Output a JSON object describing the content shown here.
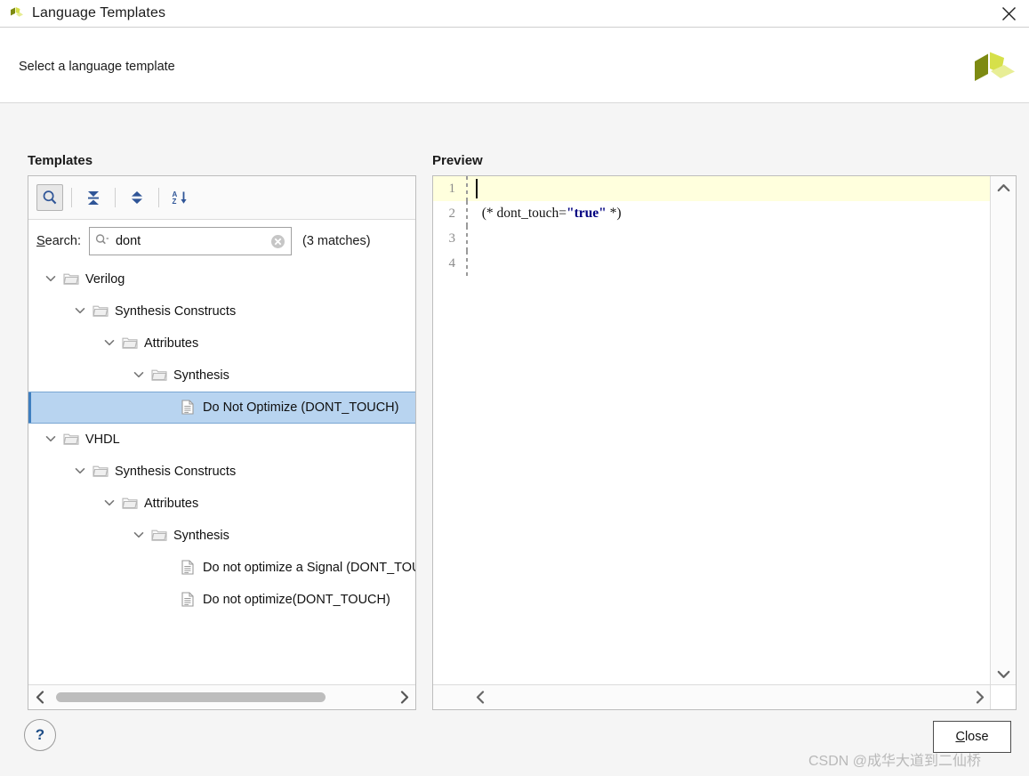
{
  "window": {
    "title": "Language Templates",
    "app_icon": "vivado-logo-icon",
    "close_icon": "close-icon"
  },
  "header": {
    "subtitle": "Select a language template",
    "brand_logo": "amd-xilinx-logo-icon"
  },
  "panels": {
    "templates_label": "Templates",
    "preview_label": "Preview"
  },
  "toolbar": {
    "buttons": [
      {
        "name": "search-toggle-button",
        "icon": "search-icon",
        "active": true
      },
      {
        "name": "collapse-all-button",
        "icon": "collapse-all-icon",
        "active": false
      },
      {
        "name": "expand-all-button",
        "icon": "expand-all-icon",
        "active": false
      },
      {
        "name": "sort-alphabetical-button",
        "icon": "sort-az-icon",
        "active": false
      }
    ]
  },
  "search": {
    "label_pre": "",
    "label_mnemonic": "S",
    "label_post": "earch:",
    "value": "dont",
    "placeholder": "",
    "mini_icon": "search-dropdown-icon",
    "clear_icon": "clear-circle-icon",
    "match_count": "(3 matches)"
  },
  "tree": {
    "rows": [
      {
        "label": "Verilog",
        "depth": 0,
        "type": "folder",
        "expanded": true,
        "selected": false
      },
      {
        "label": "Synthesis Constructs",
        "depth": 1,
        "type": "folder",
        "expanded": true,
        "selected": false
      },
      {
        "label": "Attributes",
        "depth": 2,
        "type": "folder",
        "expanded": true,
        "selected": false
      },
      {
        "label": "Synthesis",
        "depth": 3,
        "type": "folder",
        "expanded": true,
        "selected": false
      },
      {
        "label": "Do Not Optimize (DONT_TOUCH)",
        "depth": 4,
        "type": "file",
        "expanded": false,
        "selected": true
      },
      {
        "label": "VHDL",
        "depth": 0,
        "type": "folder",
        "expanded": true,
        "selected": false
      },
      {
        "label": "Synthesis Constructs",
        "depth": 1,
        "type": "folder",
        "expanded": true,
        "selected": false
      },
      {
        "label": "Attributes",
        "depth": 2,
        "type": "folder",
        "expanded": true,
        "selected": false
      },
      {
        "label": "Synthesis",
        "depth": 3,
        "type": "folder",
        "expanded": true,
        "selected": false
      },
      {
        "label": "Do not optimize a Signal (DONT_TOUCH)",
        "depth": 4,
        "type": "file",
        "expanded": false,
        "selected": false
      },
      {
        "label": "Do not optimize(DONT_TOUCH)",
        "depth": 4,
        "type": "file",
        "expanded": false,
        "selected": false
      }
    ],
    "hscroll": {
      "left_arrow_icon": "chevron-left-icon",
      "right_arrow_icon": "chevron-right-icon"
    }
  },
  "preview": {
    "lines": [
      {
        "number": "1",
        "pre": "",
        "token": "",
        "post": "",
        "current": true
      },
      {
        "number": "2",
        "pre": "  (* dont_touch=",
        "token": "\"true\"",
        "post": " *)",
        "current": false
      },
      {
        "number": "3",
        "pre": "",
        "token": "",
        "post": "",
        "current": false
      },
      {
        "number": "4",
        "pre": "",
        "token": "",
        "post": "",
        "current": false
      }
    ],
    "scroll": {
      "up_arrow_icon": "chevron-up-icon",
      "down_arrow_icon": "chevron-down-icon",
      "left_arrow_icon": "chevron-left-icon",
      "right_arrow_icon": "chevron-right-icon"
    },
    "colors": {
      "current_line_bg": "#ffffdd",
      "string_token": "#000080",
      "gutter_text": "#8c8c8c"
    }
  },
  "footer": {
    "help_label": "?",
    "close_mnemonic": "C",
    "close_rest": "lose",
    "watermark": "CSDN @成华大道到二仙桥"
  }
}
